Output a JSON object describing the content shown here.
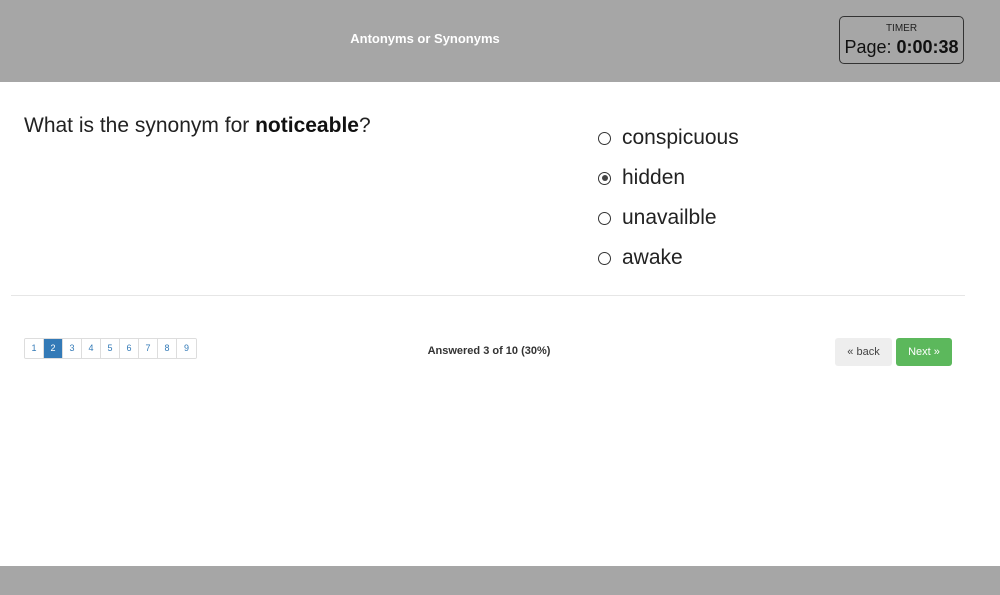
{
  "header": {
    "title": "Antonyms or Synonyms",
    "timer_label": "TIMER",
    "timer_prefix": "Page: ",
    "timer_value": "0:00:38"
  },
  "question": {
    "prefix": "What is the synonym for ",
    "keyword": "noticeable",
    "suffix": "?"
  },
  "options": [
    {
      "label": "conspicuous",
      "selected": false
    },
    {
      "label": "hidden",
      "selected": true
    },
    {
      "label": "unavailble",
      "selected": false
    },
    {
      "label": "awake",
      "selected": false
    }
  ],
  "pagination": {
    "pages": [
      "1",
      "2",
      "3",
      "4",
      "5",
      "6",
      "7",
      "8",
      "9"
    ],
    "active_page": "2"
  },
  "progress": {
    "text": "Answered 3 of 10 (30%)",
    "answered": 3,
    "total": 10
  },
  "buttons": {
    "back_label": "« back",
    "next_label": "Next »"
  },
  "colors": {
    "header_bg": "#a6a6a6",
    "active_page": "#337ab7",
    "next_button": "#5cb85c"
  }
}
